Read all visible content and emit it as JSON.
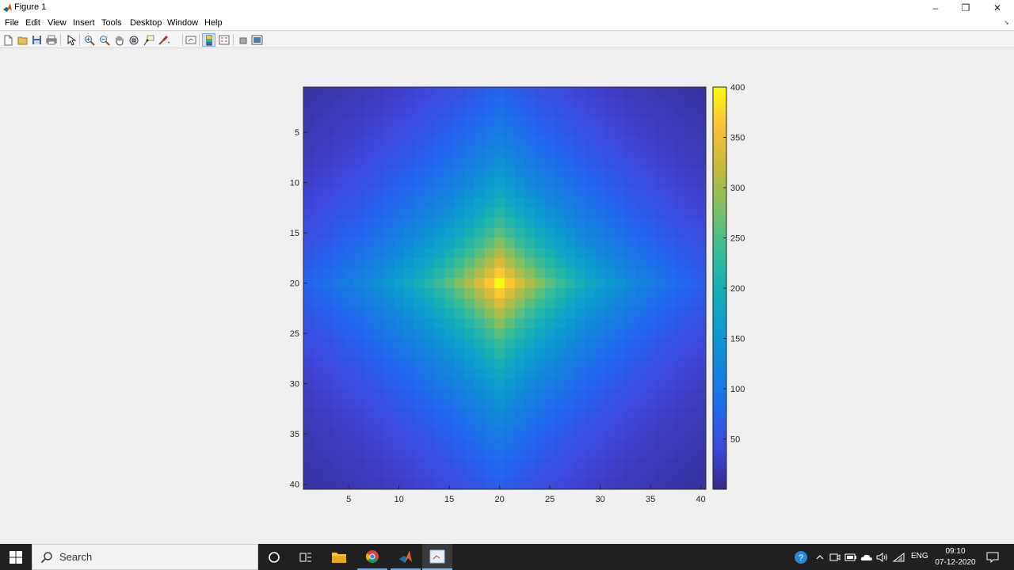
{
  "window": {
    "title": "Figure 1",
    "controls": {
      "minimize": "–",
      "restore": "❐",
      "close": "✕"
    }
  },
  "menu": [
    "File",
    "Edit",
    "View",
    "Insert",
    "Tools",
    "Desktop",
    "Window",
    "Help"
  ],
  "toolbar": {
    "buttons": [
      "new-figure",
      "open-file",
      "save",
      "print",
      "edit-plot",
      "zoom-in",
      "zoom-out",
      "pan",
      "rotate-3d",
      "data-cursor",
      "brush",
      "link-plot",
      "insert-colorbar",
      "insert-legend",
      "hide-plot-tools",
      "show-plot-tools"
    ]
  },
  "chart_data": {
    "type": "heatmap",
    "title": "",
    "xlabel": "",
    "ylabel": "",
    "x_ticks": [
      "5",
      "10",
      "15",
      "20",
      "25",
      "30",
      "35",
      "40"
    ],
    "y_ticks": [
      "5",
      "10",
      "15",
      "20",
      "25",
      "30",
      "35",
      "40"
    ],
    "colorbar_ticks": [
      "50",
      "100",
      "150",
      "200",
      "250",
      "300",
      "350",
      "400"
    ],
    "rows": 40,
    "cols": 40,
    "xlim": [
      0.5,
      40.5
    ],
    "ylim": [
      0.5,
      40.5
    ],
    "y_direction": "reverse",
    "clim": [
      0,
      400
    ],
    "peak": {
      "row": 20,
      "col": 20,
      "value": 400
    },
    "colormap": "parula",
    "colorbar": "right"
  },
  "taskbar": {
    "search_placeholder": "Search",
    "apps": [
      "cortana-icon",
      "task-view-icon",
      "file-explorer-icon",
      "chrome-icon",
      "matlab-icon",
      "figure-window-icon"
    ],
    "tray": [
      "help-icon",
      "show-hidden-icons",
      "meet-now-icon",
      "battery-icon",
      "onedrive-icon",
      "volume-icon",
      "wifi-icon"
    ],
    "language": "ENG",
    "time": "09:10",
    "date": "07-12-2020"
  }
}
